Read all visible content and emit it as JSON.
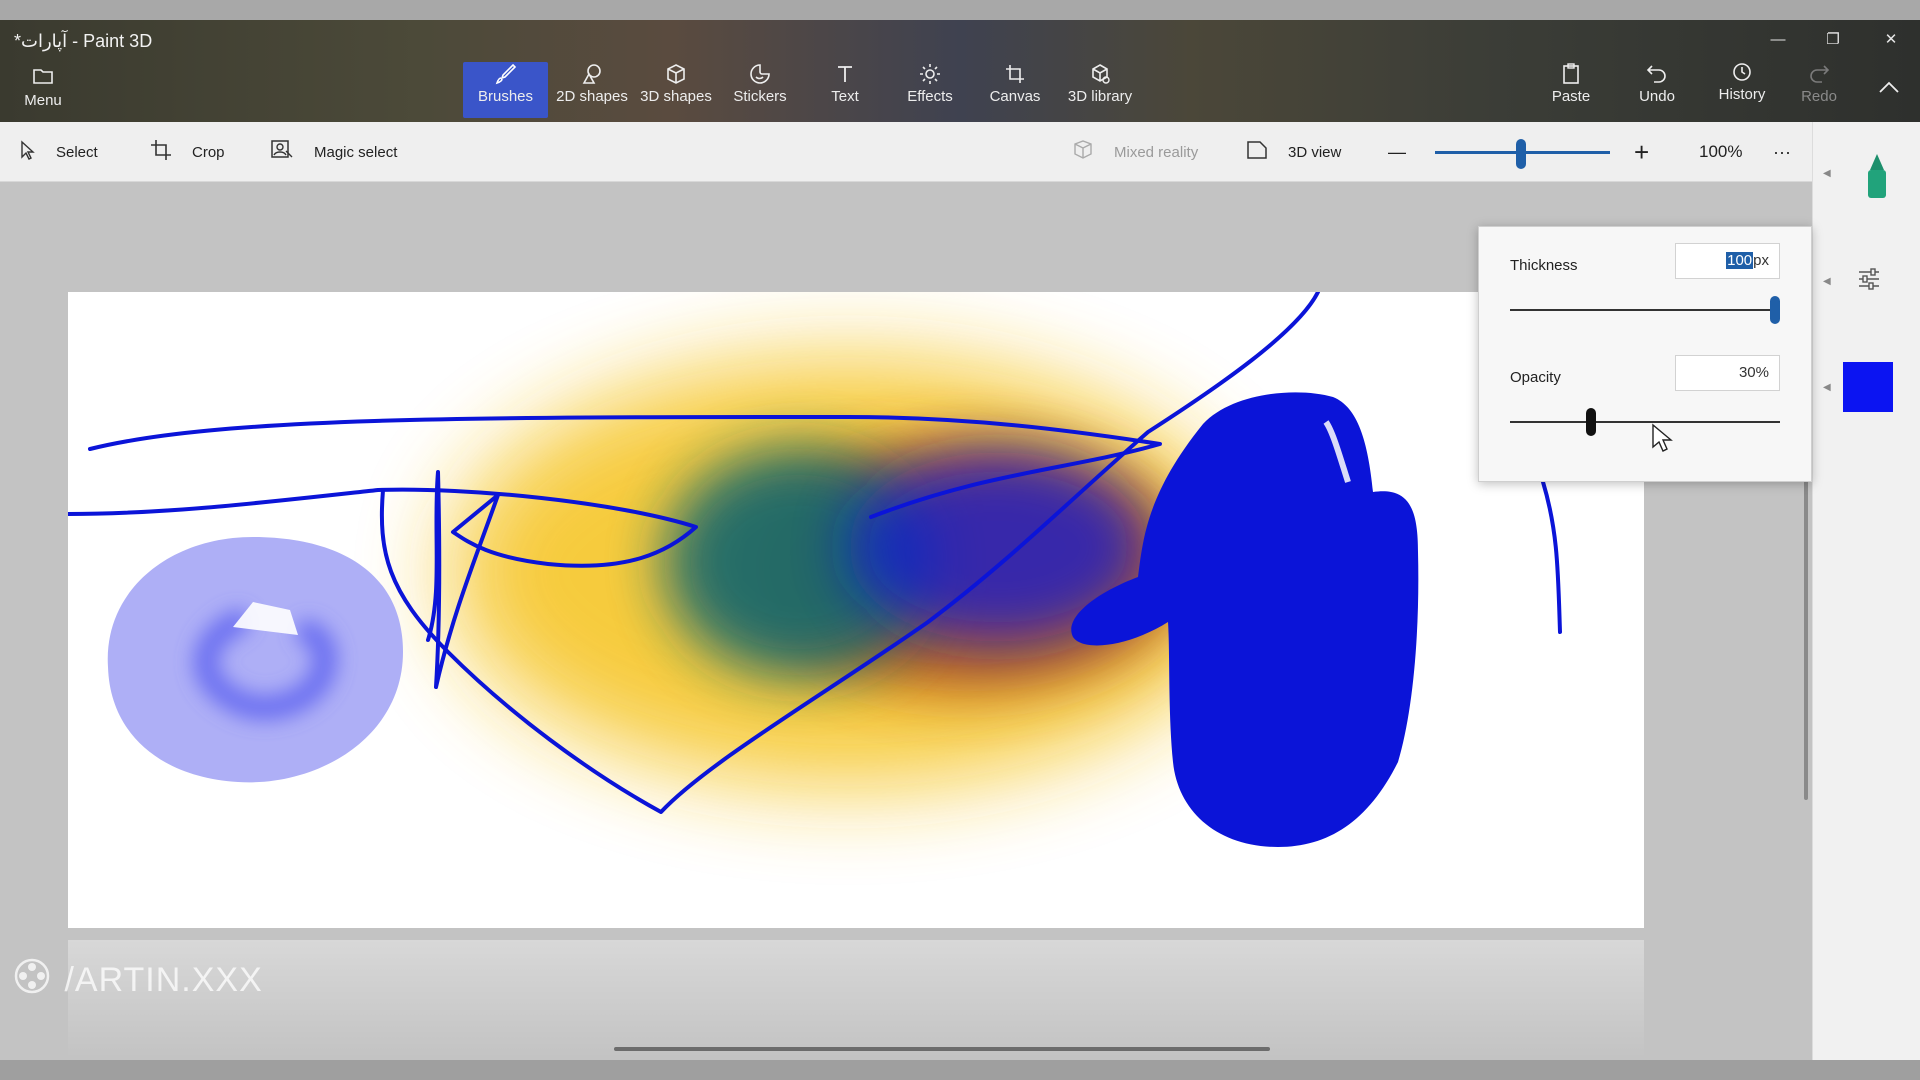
{
  "window": {
    "title": "*آپارات - Paint 3D",
    "minimize_glyph": "—",
    "restore_glyph": "❐",
    "close_glyph": "✕"
  },
  "ribbon": {
    "menu": {
      "label": "Menu",
      "icon": "folder-icon"
    },
    "tools": [
      {
        "label": "Brushes",
        "icon": "brush-icon",
        "active": true
      },
      {
        "label": "2D shapes",
        "icon": "2d-shapes-icon"
      },
      {
        "label": "3D shapes",
        "icon": "3d-cube-icon"
      },
      {
        "label": "Stickers",
        "icon": "sticker-icon"
      },
      {
        "label": "Text",
        "icon": "text-icon"
      },
      {
        "label": "Effects",
        "icon": "sun-icon"
      },
      {
        "label": "Canvas",
        "icon": "canvas-crop-icon"
      },
      {
        "label": "3D library",
        "icon": "3d-library-icon"
      }
    ],
    "right": [
      {
        "label": "Paste",
        "icon": "clipboard-icon"
      },
      {
        "label": "Undo",
        "icon": "undo-icon"
      },
      {
        "label": "History",
        "icon": "history-icon"
      },
      {
        "label": "Redo",
        "icon": "redo-icon",
        "disabled": true
      }
    ]
  },
  "subbar": {
    "select": "Select",
    "crop": "Crop",
    "magic_select": "Magic select",
    "mixed_reality": "Mixed reality",
    "view_3d": "3D view",
    "zoom_out": "—",
    "zoom_in": "+",
    "zoom": "100%",
    "zoom_level_fraction": 0.5,
    "more": "···"
  },
  "brush_settings": {
    "thickness_label": "Thickness",
    "thickness_value": "100",
    "thickness_unit": "px",
    "thickness_fraction": 1.0,
    "opacity_label": "Opacity",
    "opacity_value": "30%",
    "opacity_fraction": 0.3
  },
  "side_panel": {
    "current_color": "#0b14f2",
    "marker_color": "#21a37b",
    "settings_icon": "sliders-icon"
  },
  "watermark": "/ARTIN.XXX",
  "colors": {
    "accent": "#1f5fa8",
    "active_tool": "#3a55c9",
    "stroke_blue": "#0b14d8",
    "airbrush_yellow": "#f5c21a",
    "airbrush_teal": "#1f6b6a",
    "airbrush_rust": "#a8451e",
    "lavender": "#aeaff6"
  }
}
